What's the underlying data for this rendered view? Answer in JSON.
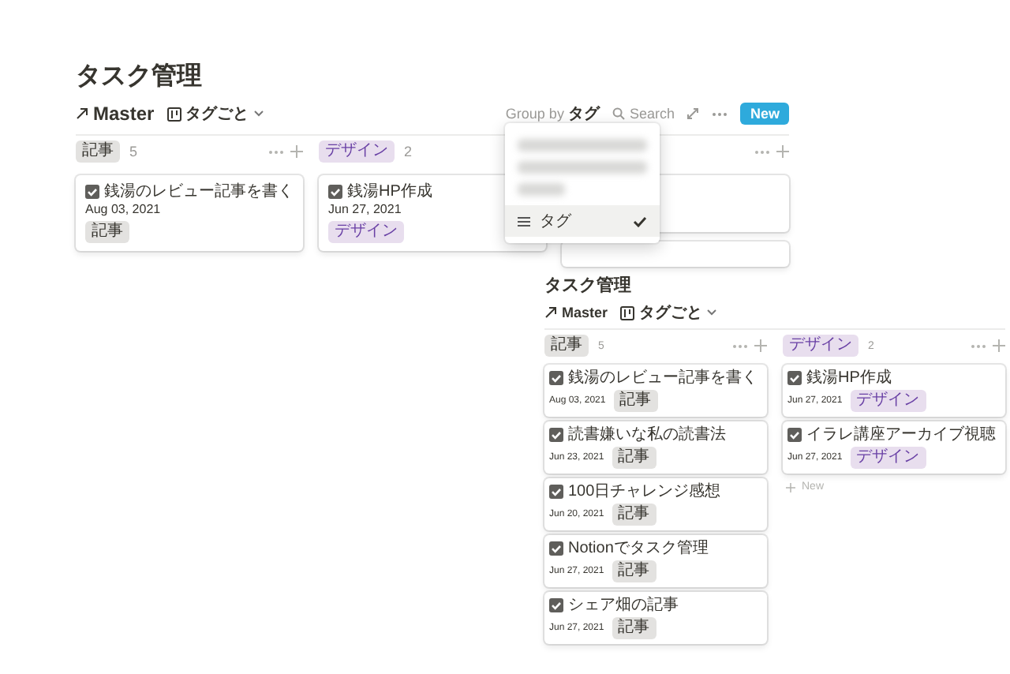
{
  "boards": [
    {
      "title": "タスク管理",
      "database": "Master",
      "view": "タグごと",
      "group_by_label": "Group by",
      "group_by_value": "タグ",
      "search": "Search",
      "new_button": "New",
      "columns": [
        {
          "kind": "group",
          "tag": "記事",
          "color": "#e3e2e0",
          "count": "5",
          "cards": [
            {
              "title": "銭湯のレビュー記事を書く",
              "date": "Aug 03, 2021",
              "tag": "記事"
            }
          ]
        },
        {
          "kind": "group",
          "tag": "デザイン",
          "color": "#e8deee",
          "count": "2",
          "cards": [
            {
              "title": "銭湯HP作成",
              "date": "Jun 27, 2021",
              "tag": "デザイン"
            }
          ]
        },
        {
          "kind": "covered"
        }
      ],
      "menu": {
        "items": [
          {
            "label": "タグ",
            "selected": true
          }
        ]
      }
    },
    {
      "title": "タスク管理",
      "database": "Master",
      "view": "タグごと",
      "columns": [
        {
          "kind": "group",
          "tag": "記事",
          "color": "#e3e2e0",
          "count": "5",
          "cards": [
            {
              "title": "銭湯のレビュー記事を書く",
              "date": "Aug 03, 2021",
              "tag": "記事"
            },
            {
              "title": "読書嫌いな私の読書法",
              "date": "Jun 23, 2021",
              "tag": "記事"
            },
            {
              "title": "100日チャレンジ感想",
              "date": "Jun 20, 2021",
              "tag": "記事"
            },
            {
              "title": "Notionでタスク管理",
              "date": "Jun 27, 2021",
              "tag": "記事"
            },
            {
              "title": "シェア畑の記事",
              "date": "Jun 27, 2021",
              "tag": "記事"
            }
          ]
        },
        {
          "kind": "group",
          "tag": "デザイン",
          "color": "#e8deee",
          "count": "2",
          "cards": [
            {
              "title": "銭湯HP作成",
              "date": "Jun 27, 2021",
              "tag": "デザイン"
            },
            {
              "title": "イラレ講座アーカイブ視聴",
              "date": "Jun 27, 2021",
              "tag": "デザイン"
            }
          ],
          "new_card": "New"
        }
      ]
    }
  ]
}
